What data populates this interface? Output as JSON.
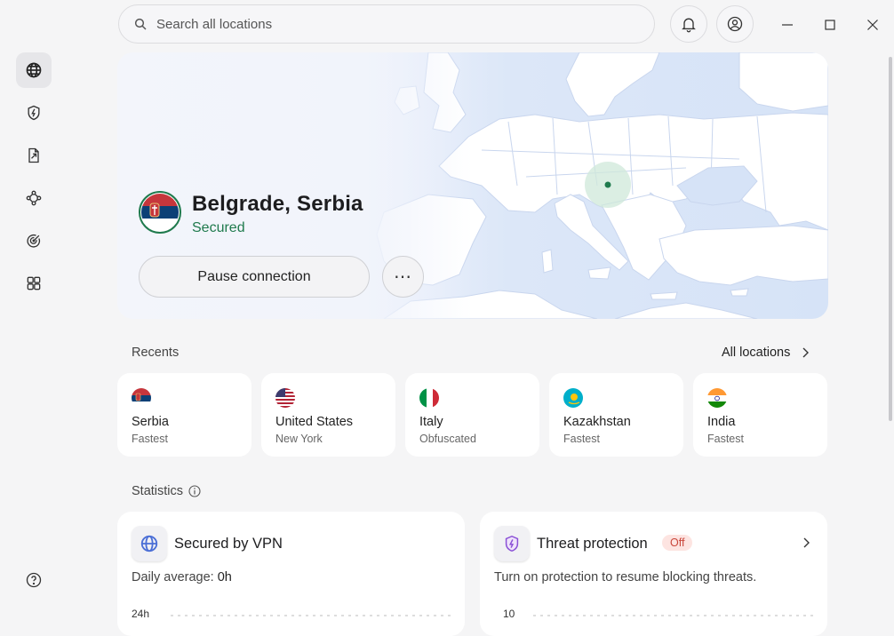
{
  "search": {
    "placeholder": "Search all locations"
  },
  "sidebar": {
    "items": [
      {
        "icon": "globe-icon"
      },
      {
        "icon": "shield-bolt-icon"
      },
      {
        "icon": "file-share-icon"
      },
      {
        "icon": "meshnet-icon"
      },
      {
        "icon": "target-icon"
      },
      {
        "icon": "apps-grid-icon"
      }
    ],
    "help_icon": "help-icon"
  },
  "connection": {
    "location": "Belgrade, Serbia",
    "status": "Secured",
    "pause_label": "Pause connection",
    "more_label": "⋯"
  },
  "recents": {
    "label": "Recents",
    "all_locations": "All locations",
    "items": [
      {
        "country": "Serbia",
        "detail": "Fastest"
      },
      {
        "country": "United States",
        "detail": "New York"
      },
      {
        "country": "Italy",
        "detail": "Obfuscated"
      },
      {
        "country": "Kazakhstan",
        "detail": "Fastest"
      },
      {
        "country": "India",
        "detail": "Fastest"
      }
    ]
  },
  "statistics": {
    "label": "Statistics",
    "vpn": {
      "title": "Secured by VPN",
      "daily_label": "Daily average: ",
      "daily_value": "0h",
      "axis_top": "24h"
    },
    "threat": {
      "title": "Threat protection",
      "badge": "Off",
      "text": "Turn on protection to resume blocking threats.",
      "axis_top": "10"
    }
  },
  "colors": {
    "secured_green": "#1f7a4d",
    "map_land": "#ffffff",
    "map_water": "#d6e3f7",
    "badge_red": "#c9463b"
  }
}
